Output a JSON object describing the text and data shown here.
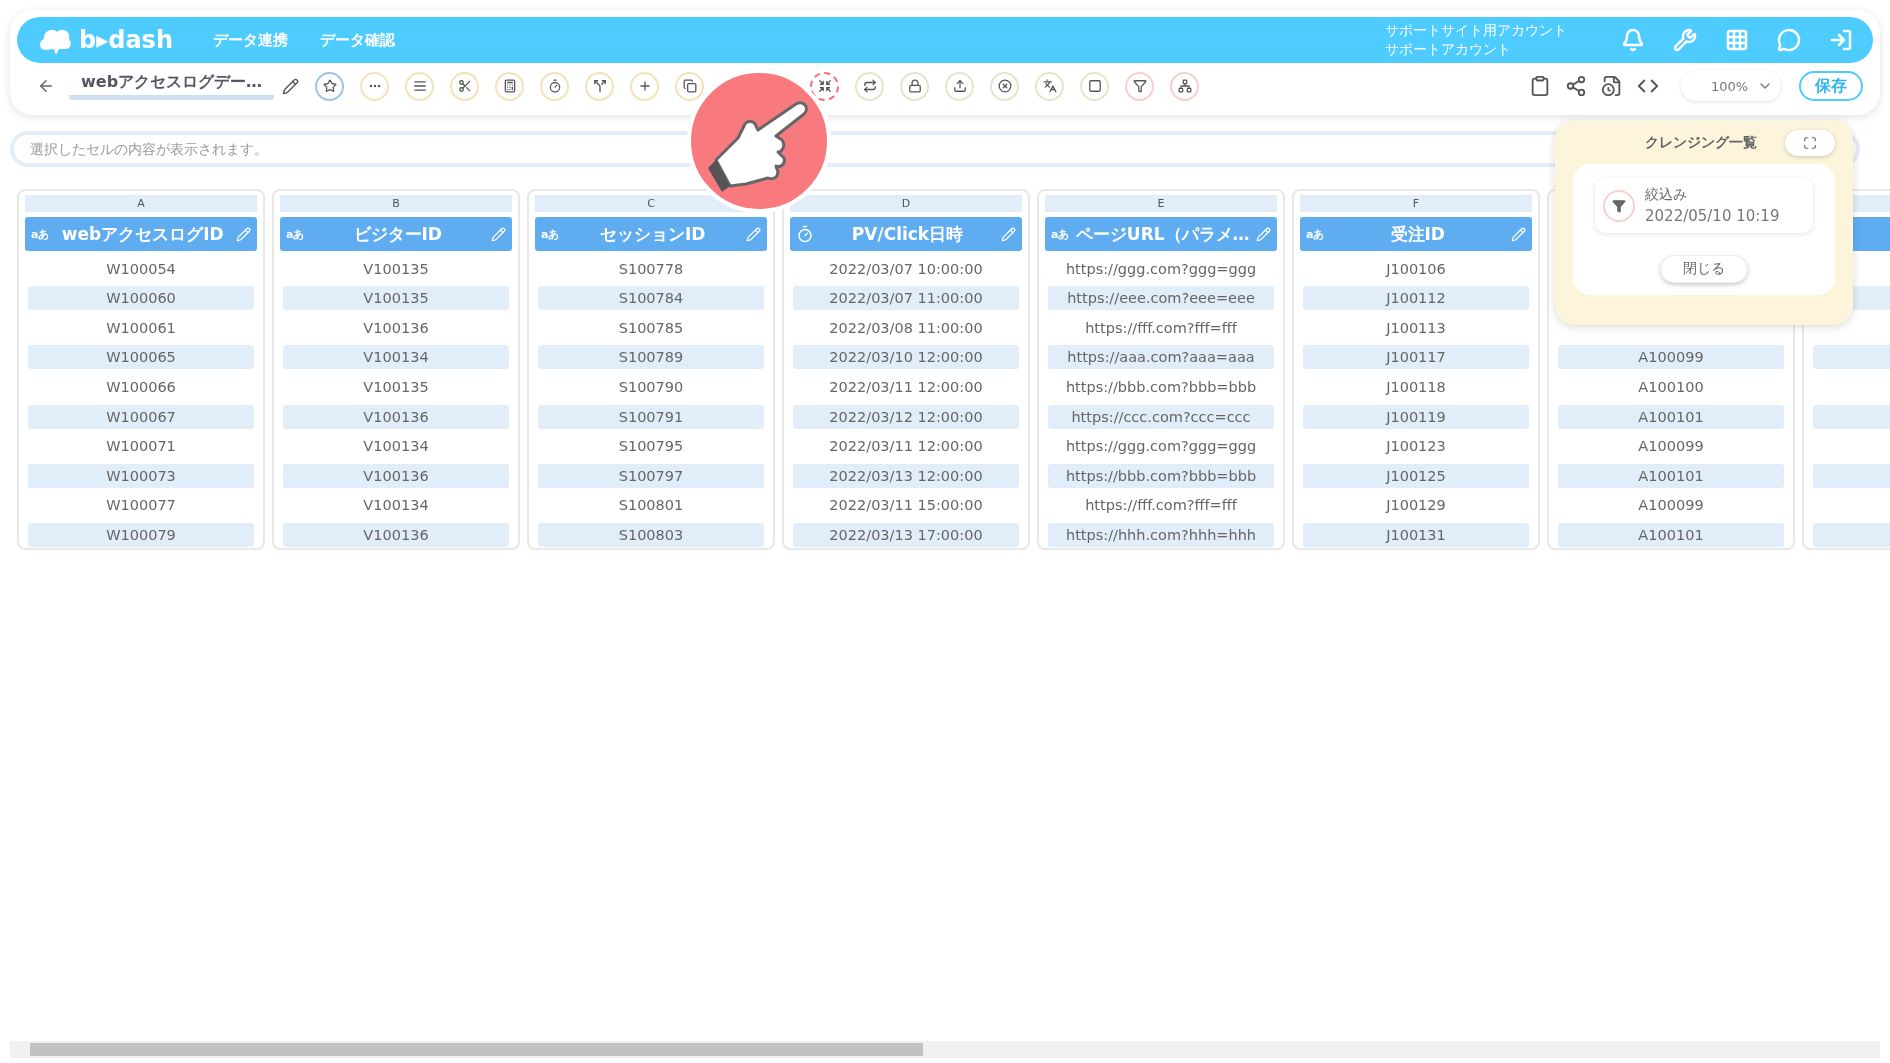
{
  "header": {
    "logo": "b▸dash",
    "nav": [
      {
        "label": "データ連携"
      },
      {
        "label": "データ確認"
      }
    ],
    "account": [
      "サポートサイト用アカウント",
      "サポートアカウント"
    ],
    "icons": [
      {
        "kind": "bell"
      },
      {
        "kind": "wrench"
      },
      {
        "kind": "apps"
      },
      {
        "kind": "chat"
      },
      {
        "kind": "logout"
      }
    ]
  },
  "toolbar": {
    "title": "webアクセスログデー…",
    "tools": [
      {
        "kind": "star",
        "color": "#9fc4e8",
        "highlighted": false
      },
      {
        "kind": "dots",
        "color": "#f3e3b5",
        "highlighted": false
      },
      {
        "kind": "lines",
        "color": "#f3e3b5",
        "highlighted": false
      },
      {
        "kind": "scissors",
        "color": "#f3e3b5",
        "highlighted": false
      },
      {
        "kind": "calc",
        "color": "#f3e3b5",
        "highlighted": false
      },
      {
        "kind": "timer",
        "color": "#f3e3b5",
        "highlighted": false
      },
      {
        "kind": "split",
        "color": "#f3e3b5",
        "highlighted": false
      },
      {
        "kind": "plus",
        "color": "#f3e3b5",
        "highlighted": false
      },
      {
        "kind": "copy",
        "color": "#f3e3b5",
        "highlighted": false
      },
      {
        "kind": "gap"
      },
      {
        "kind": "shrink",
        "highlighted": true
      },
      {
        "kind": "repeat",
        "color": "#dfe8c8",
        "highlighted": false
      },
      {
        "kind": "lock",
        "color": "#dfe8c8",
        "highlighted": false
      },
      {
        "kind": "upload",
        "color": "#dfe8c8",
        "highlighted": false
      },
      {
        "kind": "cancel",
        "color": "#dfe8c8",
        "highlighted": false
      },
      {
        "kind": "translate",
        "color": "#dfe8c8",
        "highlighted": false
      },
      {
        "kind": "zero",
        "color": "#dfe8c8",
        "highlighted": false
      },
      {
        "kind": "filter",
        "color": "#f8cfcf",
        "highlighted": false
      },
      {
        "kind": "tree",
        "color": "#f8cfcf",
        "highlighted": false
      }
    ],
    "right_icons": [
      {
        "kind": "clipboard"
      },
      {
        "kind": "share"
      },
      {
        "kind": "refresh"
      },
      {
        "kind": "code"
      }
    ],
    "zoom": "100%",
    "save": "保存"
  },
  "cell_field": {
    "placeholder": "選択したセルの内容が表示されます。"
  },
  "columns": [
    {
      "letter": "A",
      "kind": "text",
      "type_label": "aあ",
      "header": "webアクセスログID",
      "cells": [
        "W100054",
        "W100060",
        "W100061",
        "W100065",
        "W100066",
        "W100067",
        "W100071",
        "W100073",
        "W100077",
        "W100079"
      ]
    },
    {
      "letter": "B",
      "kind": "text",
      "type_label": "aあ",
      "header": "ビジターID",
      "cells": [
        "V100135",
        "V100135",
        "V100136",
        "V100134",
        "V100135",
        "V100136",
        "V100134",
        "V100136",
        "V100134",
        "V100136"
      ]
    },
    {
      "letter": "C",
      "kind": "text",
      "type_label": "aあ",
      "header": "セッションID",
      "cells": [
        "S100778",
        "S100784",
        "S100785",
        "S100789",
        "S100790",
        "S100791",
        "S100795",
        "S100797",
        "S100801",
        "S100803"
      ]
    },
    {
      "letter": "D",
      "kind": "datetime",
      "header": "PV/Click日時",
      "cells": [
        "2022/03/07 10:00:00",
        "2022/03/07 11:00:00",
        "2022/03/08 11:00:00",
        "2022/03/10 12:00:00",
        "2022/03/11 12:00:00",
        "2022/03/12 12:00:00",
        "2022/03/11 12:00:00",
        "2022/03/13 12:00:00",
        "2022/03/11 15:00:00",
        "2022/03/13 17:00:00"
      ]
    },
    {
      "letter": "E",
      "kind": "text",
      "type_label": "aあ",
      "header": "ページURL（パラメ…",
      "cells": [
        "https://ggg.com?ggg=ggg",
        "https://eee.com?eee=eee",
        "https://fff.com?fff=fff",
        "https://aaa.com?aaa=aaa",
        "https://bbb.com?bbb=bbb",
        "https://ccc.com?ccc=ccc",
        "https://ggg.com?ggg=ggg",
        "https://bbb.com?bbb=bbb",
        "https://fff.com?fff=fff",
        "https://hhh.com?hhh=hhh"
      ]
    },
    {
      "letter": "F",
      "kind": "text",
      "type_label": "aあ",
      "header": "受注ID",
      "cells": [
        "J100106",
        "J100112",
        "J100113",
        "J100117",
        "J100118",
        "J100119",
        "J100123",
        "J100125",
        "J100129",
        "J100131"
      ]
    },
    {
      "kind": "covered",
      "cells": [
        "A100099",
        "A100100",
        "A100101",
        "A100099",
        "A100101",
        "A100099",
        "A100101"
      ]
    }
  ],
  "cleansing_panel": {
    "title": "クレンジング一覧",
    "items": [
      {
        "name": "絞込み",
        "time": "2022/05/10 10:19"
      }
    ],
    "close": "閉じる"
  }
}
